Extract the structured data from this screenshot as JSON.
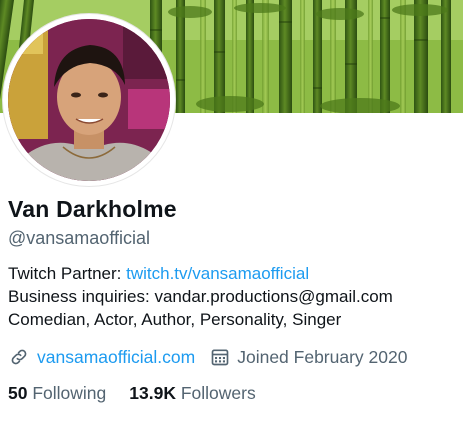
{
  "profile": {
    "display_name": "Van Darkholme",
    "handle": "@vansamaofficial"
  },
  "bio": {
    "line1_prefix": "Twitch Partner: ",
    "line1_link": "twitch.tv/vansamaofficial",
    "line2": "Business inquiries: vandar.productions@gmail.com",
    "line3": "Comedian, Actor, Author, Personality, Singer"
  },
  "meta": {
    "website": "vansamaofficial.com",
    "joined": "Joined February 2020",
    "link_icon": "link-icon",
    "calendar_icon": "calendar-icon"
  },
  "stats": {
    "following_count": "50",
    "following_label": "Following",
    "followers_count": "13.9K",
    "followers_label": "Followers"
  },
  "colors": {
    "link": "#1d9bf0",
    "secondary_text": "#536471",
    "primary_text": "#0f1419",
    "banner_green": "#7aa834"
  }
}
